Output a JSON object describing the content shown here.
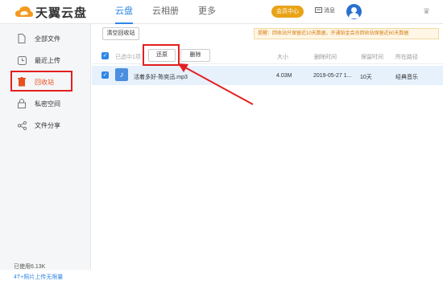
{
  "app": {
    "name": "天翼云盘"
  },
  "nav": [
    {
      "label": "云盘"
    },
    {
      "label": "云相册"
    },
    {
      "label": "更多"
    }
  ],
  "header": {
    "vip_label": "会员中心",
    "message_label": "消息"
  },
  "sidebar": {
    "items": [
      {
        "label": "全部文件",
        "icon": "file-icon"
      },
      {
        "label": "最近上传",
        "icon": "clock-icon"
      },
      {
        "label": "回收站",
        "icon": "trash-icon"
      },
      {
        "label": "私密空间",
        "icon": "lock-icon"
      },
      {
        "label": "文件分享",
        "icon": "share-icon"
      }
    ],
    "storage": "已使用6.13K",
    "upgrade": "4T+照片上传无限量"
  },
  "toolbar": {
    "clear_label": "清空回收站",
    "notice": "提醒：回收站只保留近10天数据，开通铂金会员回收站保留近60天数据"
  },
  "table": {
    "selected_text": "已选中1项",
    "restore_label": "还原",
    "delete_label": "删除",
    "columns": [
      "大小",
      "删除时间",
      "保留时间",
      "所在路径"
    ],
    "rows": [
      {
        "name": "活着多好-陈奕迅.mp3",
        "size": "4.03M",
        "deleted": "2019-05-27 1...",
        "keep": "10天",
        "path": "经典音乐"
      }
    ]
  },
  "colors": {
    "accent": "#2f86e6",
    "highlight": "#e32020",
    "active": "#e8501e"
  }
}
